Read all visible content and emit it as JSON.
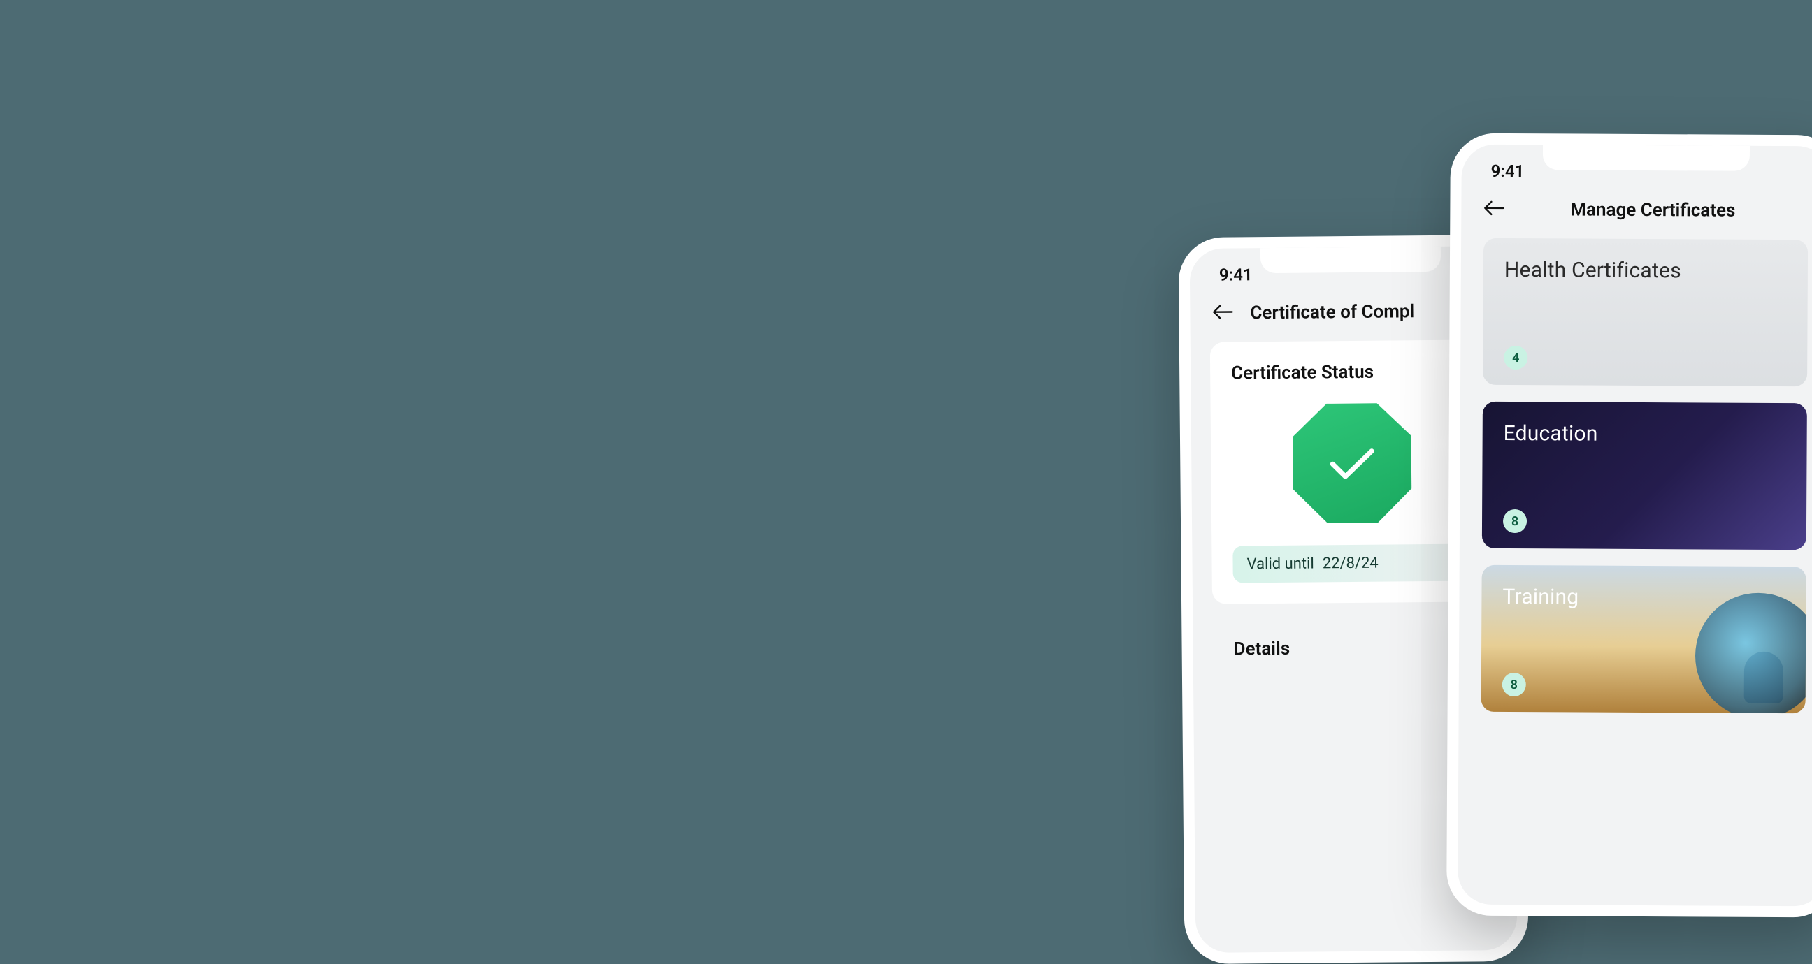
{
  "status_time": "9:41",
  "phone_a": {
    "nav_title": "Certificate of Compl",
    "status_heading": "Certificate Status",
    "valid_label": "Valid until",
    "valid_date": "22/8/24",
    "details_heading": "Details"
  },
  "phone_b": {
    "nav_title": "Manage Certificates",
    "categories": [
      {
        "title": "Health Certificates",
        "count": "4"
      },
      {
        "title": "Education",
        "count": "8"
      },
      {
        "title": "Training",
        "count": "8"
      }
    ]
  }
}
